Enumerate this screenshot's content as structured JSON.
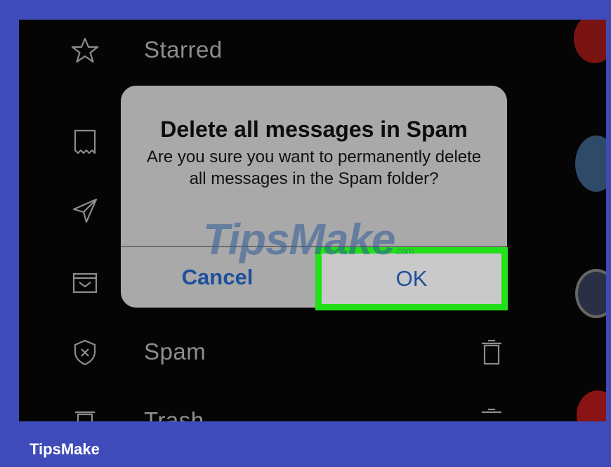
{
  "menu": {
    "items": [
      {
        "label": "Starred",
        "icon": "star-icon"
      },
      {
        "label": "",
        "icon": "important-tag-icon"
      },
      {
        "label": "",
        "icon": "send-icon"
      },
      {
        "label": "",
        "icon": "archive-icon"
      },
      {
        "label": "Spam",
        "icon": "shield-x-icon"
      },
      {
        "label": "Trash",
        "icon": "trash-icon"
      }
    ]
  },
  "dialog": {
    "title": "Delete all messages in Spam",
    "message": "Are you sure you want to permanently delete all messages in the Spam folder?",
    "cancel_label": "Cancel",
    "ok_label": "OK"
  },
  "watermark": {
    "text": "TipsMake",
    "suffix": ".com"
  },
  "footer": {
    "brand": "TipsMake"
  },
  "colors": {
    "frame": "#3f4bb8",
    "highlight": "#22e01a",
    "button_text": "#1d4f9c"
  }
}
